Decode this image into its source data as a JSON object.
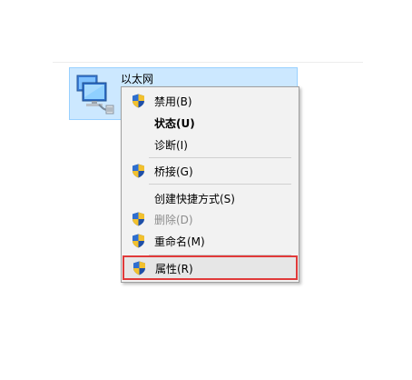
{
  "network_item": {
    "name": "以太网"
  },
  "context_menu": {
    "items": [
      {
        "label": "禁用(B)",
        "shield": true,
        "bold": false,
        "disabled": false
      },
      {
        "label": "状态(U)",
        "shield": false,
        "bold": true,
        "disabled": false
      },
      {
        "label": "诊断(I)",
        "shield": false,
        "bold": false,
        "disabled": false
      },
      {
        "label": "桥接(G)",
        "shield": true,
        "bold": false,
        "disabled": false
      },
      {
        "label": "创建快捷方式(S)",
        "shield": false,
        "bold": false,
        "disabled": false
      },
      {
        "label": "删除(D)",
        "shield": true,
        "bold": false,
        "disabled": true
      },
      {
        "label": "重命名(M)",
        "shield": true,
        "bold": false,
        "disabled": false
      },
      {
        "label": "属性(R)",
        "shield": true,
        "bold": false,
        "disabled": false,
        "highlighted": true
      }
    ]
  },
  "colors": {
    "selection_bg": "#cce8ff",
    "selection_border": "#99d1ff",
    "menu_bg": "#f2f2f2",
    "highlight_border": "#e03a3a"
  }
}
